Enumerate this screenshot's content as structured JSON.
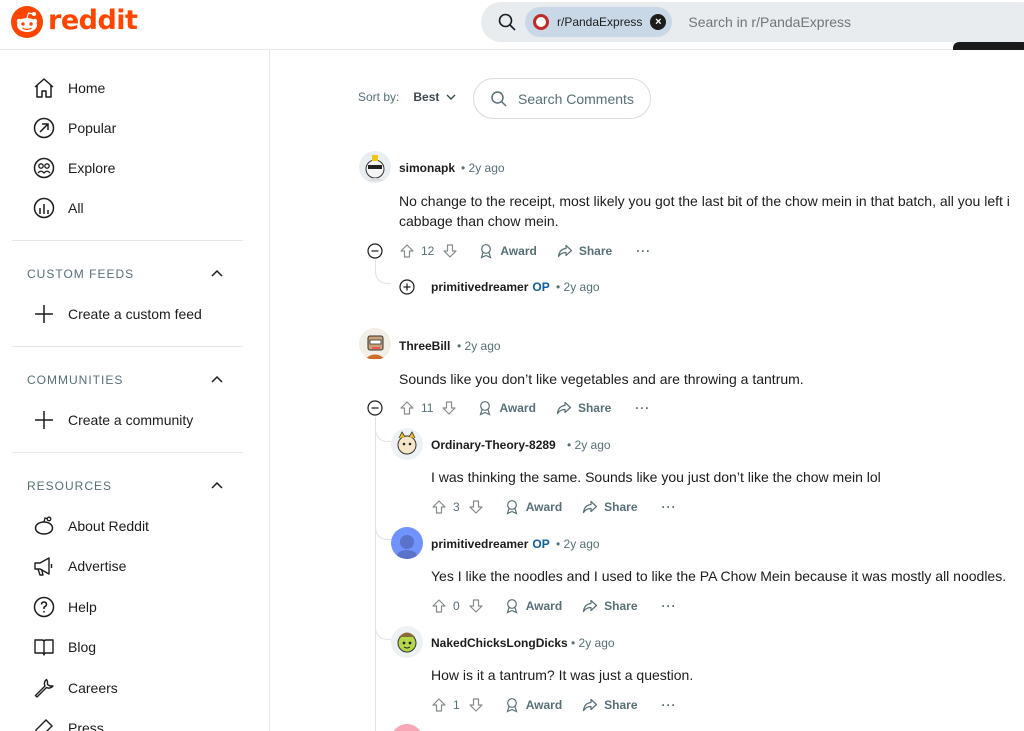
{
  "header": {
    "logo_text": "reddit",
    "search_chip": "r/PandaExpress",
    "search_placeholder": "Search in r/PandaExpress",
    "icons": [
      "search-icon",
      "close-icon"
    ]
  },
  "sidebar": {
    "items": [
      {
        "label": "Home",
        "icon": "home-icon"
      },
      {
        "label": "Popular",
        "icon": "popular-icon"
      },
      {
        "label": "Explore",
        "icon": "explore-icon"
      },
      {
        "label": "All",
        "icon": "all-icon"
      }
    ],
    "custom_feeds": {
      "title": "CUSTOM FEEDS",
      "create_label": "Create a custom feed"
    },
    "communities": {
      "title": "COMMUNITIES",
      "create_label": "Create a community"
    },
    "resources": {
      "title": "RESOURCES",
      "items": [
        {
          "label": "About Reddit",
          "icon": "reddit-icon"
        },
        {
          "label": "Advertise",
          "icon": "megaphone-icon"
        },
        {
          "label": "Help",
          "icon": "help-icon"
        },
        {
          "label": "Blog",
          "icon": "book-icon"
        },
        {
          "label": "Careers",
          "icon": "wrench-icon"
        },
        {
          "label": "Press",
          "icon": "press-icon"
        }
      ]
    }
  },
  "toolbar": {
    "sort_label": "Sort by:",
    "sort_value": "Best",
    "comment_search_placeholder": "Search Comments"
  },
  "actions": {
    "award": "Award",
    "share": "Share",
    "more": "···"
  },
  "comments": [
    {
      "author": "simonapk",
      "op": "",
      "time": "• 2y ago",
      "text_lines": [
        "No change to the receipt, most likely you got the last bit of the chow mein in that batch, all you left i",
        "cabbage than chow mein."
      ],
      "votes": "12"
    },
    {
      "author": "primitivedreamer",
      "op": "OP",
      "time": "• 2y ago",
      "collapsed": true
    },
    {
      "author": "ThreeBill",
      "op": "",
      "time": "• 2y ago",
      "text_lines": [
        "Sounds like you don’t like vegetables and are throwing a tantrum."
      ],
      "votes": "11"
    },
    {
      "author": "Ordinary-Theory-8289",
      "op": "",
      "time": "• 2y ago",
      "text_lines": [
        "I was thinking the same. Sounds like you just don’t like the chow mein lol"
      ],
      "votes": "3"
    },
    {
      "author": "primitivedreamer",
      "op": "OP",
      "time": "• 2y ago",
      "text_lines": [
        "Yes I like the noodles and I used to like the PA Chow Mein because it was mostly all noodles."
      ],
      "votes": "0"
    },
    {
      "author": "NakedChicksLongDicks",
      "op": "",
      "time": "• 2y ago",
      "text_lines": [
        "How is it a tantrum? It was just a question."
      ],
      "votes": "1"
    }
  ],
  "colors": {
    "brand": "#ff4500",
    "op": "#0a5ea8",
    "muted": "#576f76"
  }
}
